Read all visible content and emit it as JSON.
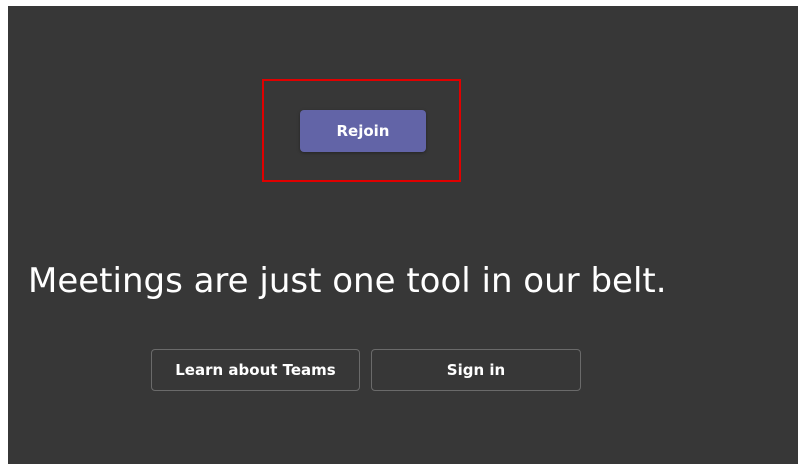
{
  "rejoin": {
    "label": "Rejoin"
  },
  "headline": "Meetings are just one tool in our belt.",
  "actions": {
    "learn_label": "Learn about Teams",
    "signin_label": "Sign in"
  },
  "colors": {
    "background": "#373737",
    "primary_button": "#6264a7",
    "highlight_border": "#e00000",
    "text": "#ffffff"
  }
}
